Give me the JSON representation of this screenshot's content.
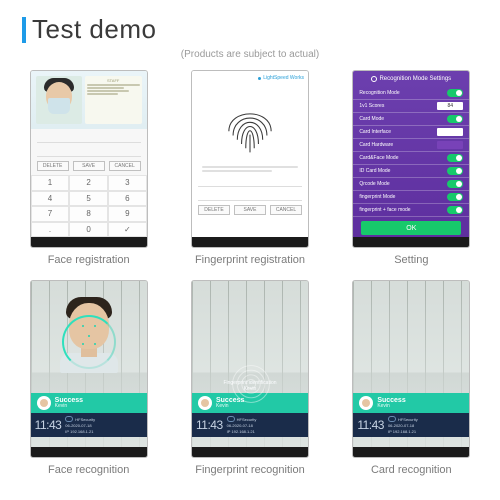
{
  "header": {
    "title": "Test demo",
    "subtitle": "(Products are subject to actual)"
  },
  "items": [
    {
      "caption": "Face registration"
    },
    {
      "caption": "Fingerprint registration"
    },
    {
      "caption": "Setting"
    },
    {
      "caption": "Face recognition"
    },
    {
      "caption": "Fingerprint recognition"
    },
    {
      "caption": "Card recognition"
    }
  ],
  "faceReg": {
    "staffLabel": "STAFF",
    "btn1": "DELETE",
    "btn2": "SAVE",
    "btn3": "CANCEL",
    "keys": [
      "1",
      "2",
      "3",
      "4",
      "5",
      "6",
      "7",
      "8",
      "9",
      ".",
      "0",
      "✓"
    ]
  },
  "fpReg": {
    "brand": "LightSpeed Works",
    "btn1": "DELETE",
    "btn2": "SAVE",
    "btn3": "CANCEL"
  },
  "settings": {
    "title": "Recognition Mode Settings",
    "rows": [
      "Recognition Mode",
      "1v1 Scores",
      "Card Mode",
      "Card Interface",
      "Card Hardware",
      "Card&Face Mode",
      "ID Card Mode",
      "Qrcode Mode",
      "fingerprint Mode",
      "fingerprint + face mode"
    ],
    "score": "84",
    "ok": "OK"
  },
  "rec": {
    "successTitle": "Success",
    "successName": "Kevin",
    "fpTitle": "Fingerprint identification",
    "clock": "11:43",
    "brand": "HFSecurity",
    "date": "06-2020-07-18",
    "ip": "IP 192.168.1.21"
  }
}
